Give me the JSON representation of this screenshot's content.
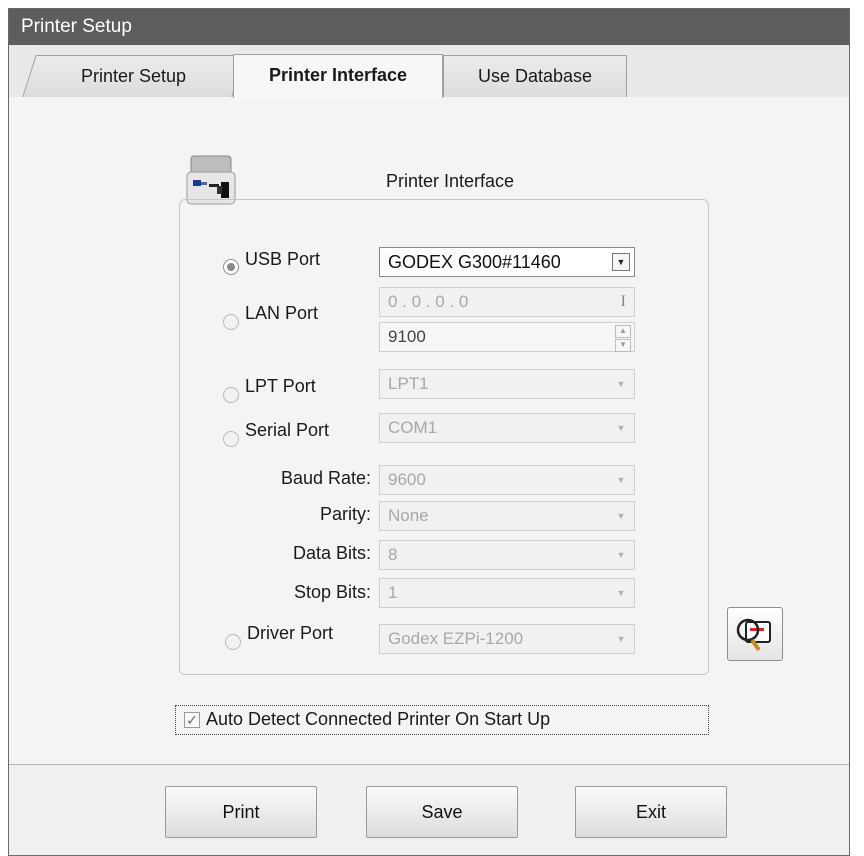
{
  "window": {
    "title": "Printer Setup"
  },
  "tabs": [
    {
      "label": "Printer Setup",
      "selected": false
    },
    {
      "label": "Printer Interface",
      "selected": true
    },
    {
      "label": "Use Database",
      "selected": false
    }
  ],
  "group": {
    "title": "Printer Interface",
    "icon": "printer-port-icon"
  },
  "ports": {
    "usb": {
      "label": "USB Port",
      "selected": true,
      "value": "GODEX G300#11460"
    },
    "lan": {
      "label": "LAN Port",
      "selected": false,
      "ip": "0 . 0 . 0 . 0",
      "port": "9100"
    },
    "lpt": {
      "label": "LPT Port",
      "selected": false,
      "value": "LPT1"
    },
    "serial": {
      "label": "Serial Port",
      "selected": false,
      "value": "COM1"
    },
    "driver": {
      "label": "Driver Port",
      "selected": false,
      "value": "Godex EZPi-1200"
    }
  },
  "serial_settings": {
    "baud_rate": {
      "label": "Baud Rate:",
      "value": "9600"
    },
    "parity": {
      "label": "Parity:",
      "value": "None"
    },
    "data_bits": {
      "label": "Data Bits:",
      "value": "8"
    },
    "stop_bits": {
      "label": "Stop Bits:",
      "value": "1"
    }
  },
  "search_button": {
    "icon": "search-printer-icon"
  },
  "auto_detect": {
    "label": "Auto Detect Connected Printer On Start Up",
    "checked": true
  },
  "buttons": {
    "print": "Print",
    "save": "Save",
    "exit": "Exit"
  },
  "colors": {
    "titlebar": "#5d5d5d",
    "background": "#f4f4f4"
  }
}
